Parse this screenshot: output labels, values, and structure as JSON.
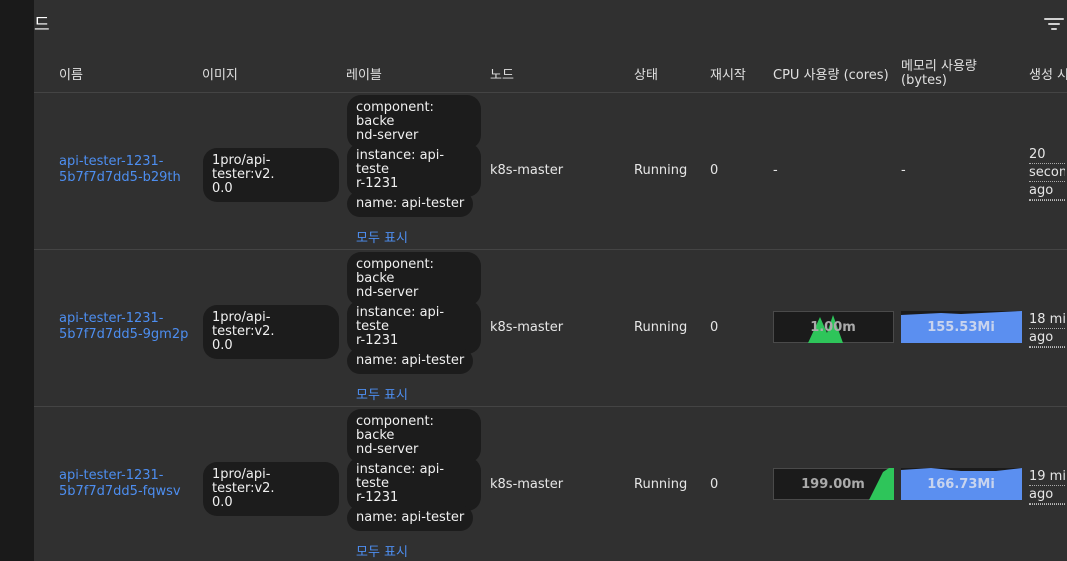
{
  "card": {
    "title": "드"
  },
  "columns": {
    "name": "이름",
    "images": "이미지",
    "labels": "레이블",
    "node": "노드",
    "status": "상태",
    "restarts": "재시작",
    "cpu": "CPU 사용량 (cores)",
    "memory_l1": "메모리 사용량",
    "memory_l2": "(bytes)",
    "created": "생성 시"
  },
  "show_all_label": "모두 표시",
  "rows": [
    {
      "name_l1": "api-tester-1231-",
      "name_l2": "5b7f7d7dd5-b29th",
      "image_l1": "1pro/api-tester:v2.",
      "image_l2": "0.0",
      "labels": [
        {
          "l1": "component: backe",
          "l2": "nd-server"
        },
        {
          "l1": "instance: api-teste",
          "l2": "r-1231"
        },
        {
          "l1": "name: api-tester",
          "l2": ""
        }
      ],
      "node": "k8s-master",
      "status": "Running",
      "restarts": "0",
      "cpu": "-",
      "memory": "-",
      "age_l1": "20",
      "age_l2": "secon",
      "age_l3": "ago"
    },
    {
      "name_l1": "api-tester-1231-",
      "name_l2": "5b7f7d7dd5-9gm2p",
      "image_l1": "1pro/api-tester:v2.",
      "image_l2": "0.0",
      "labels": [
        {
          "l1": "component: backe",
          "l2": "nd-server"
        },
        {
          "l1": "instance: api-teste",
          "l2": "r-1231"
        },
        {
          "l1": "name: api-tester",
          "l2": ""
        }
      ],
      "node": "k8s-master",
      "status": "Running",
      "restarts": "0",
      "cpu": "1.00m",
      "memory": "155.53Mi",
      "age_l1": "18 mi",
      "age_l2": "ago"
    },
    {
      "name_l1": "api-tester-1231-",
      "name_l2": "5b7f7d7dd5-fqwsv",
      "image_l1": "1pro/api-tester:v2.",
      "image_l2": "0.0",
      "labels": [
        {
          "l1": "component: backe",
          "l2": "nd-server"
        },
        {
          "l1": "instance: api-teste",
          "l2": "r-1231"
        },
        {
          "l1": "name: api-tester",
          "l2": ""
        }
      ],
      "node": "k8s-master",
      "status": "Running",
      "restarts": "0",
      "cpu": "199.00m",
      "memory": "166.73Mi",
      "age_l1": "19 mi",
      "age_l2": "ago"
    }
  ],
  "colors": {
    "link": "#4d8ef0",
    "cpu_spark": "#2ec55a",
    "memory_spark": "#5b8ff0",
    "chip_bg": "#1c1c1c"
  }
}
